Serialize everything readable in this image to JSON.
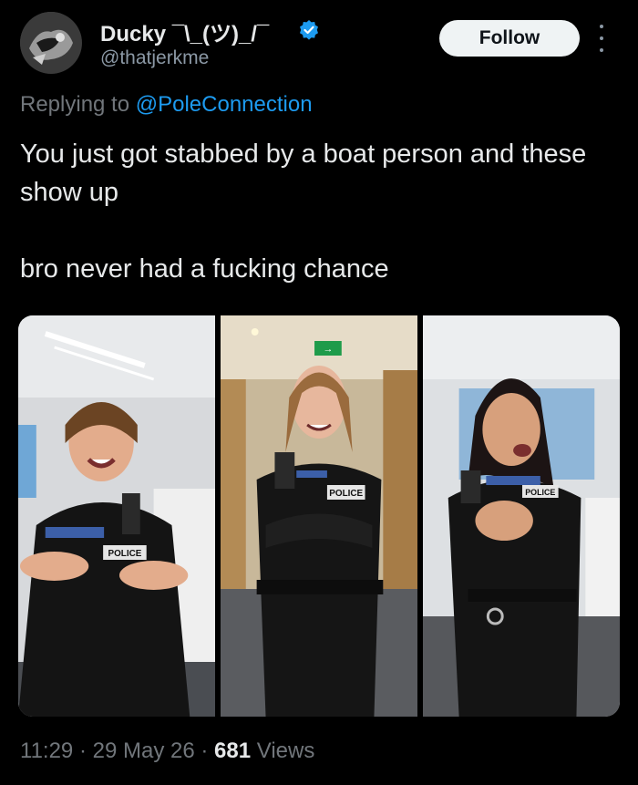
{
  "author": {
    "display_name": "Ducky ¯\\_(ツ)_/¯",
    "handle": "@thatjerkme",
    "verified": true,
    "avatar_icon": "avatar-image"
  },
  "follow_label": "Follow",
  "reply": {
    "prefix": "Replying to",
    "mention": "@PoleConnection"
  },
  "tweet": {
    "line1": "You just got stabbed by a boat person and these show up",
    "line2": "bro never had a fucking chance"
  },
  "media": {
    "photos": [
      {
        "badge": "POLICE"
      },
      {
        "badge": "POLICE"
      },
      {
        "badge": "POLICE"
      }
    ],
    "exit_sign": "→"
  },
  "meta": {
    "time": "11:29",
    "date": "29 May 26",
    "views_count": "681",
    "views_label": "Views",
    "separator": "·"
  },
  "colors": {
    "accent": "#1d9bf0",
    "muted": "#71767b",
    "text": "#e7e9ea",
    "background": "#000000"
  }
}
